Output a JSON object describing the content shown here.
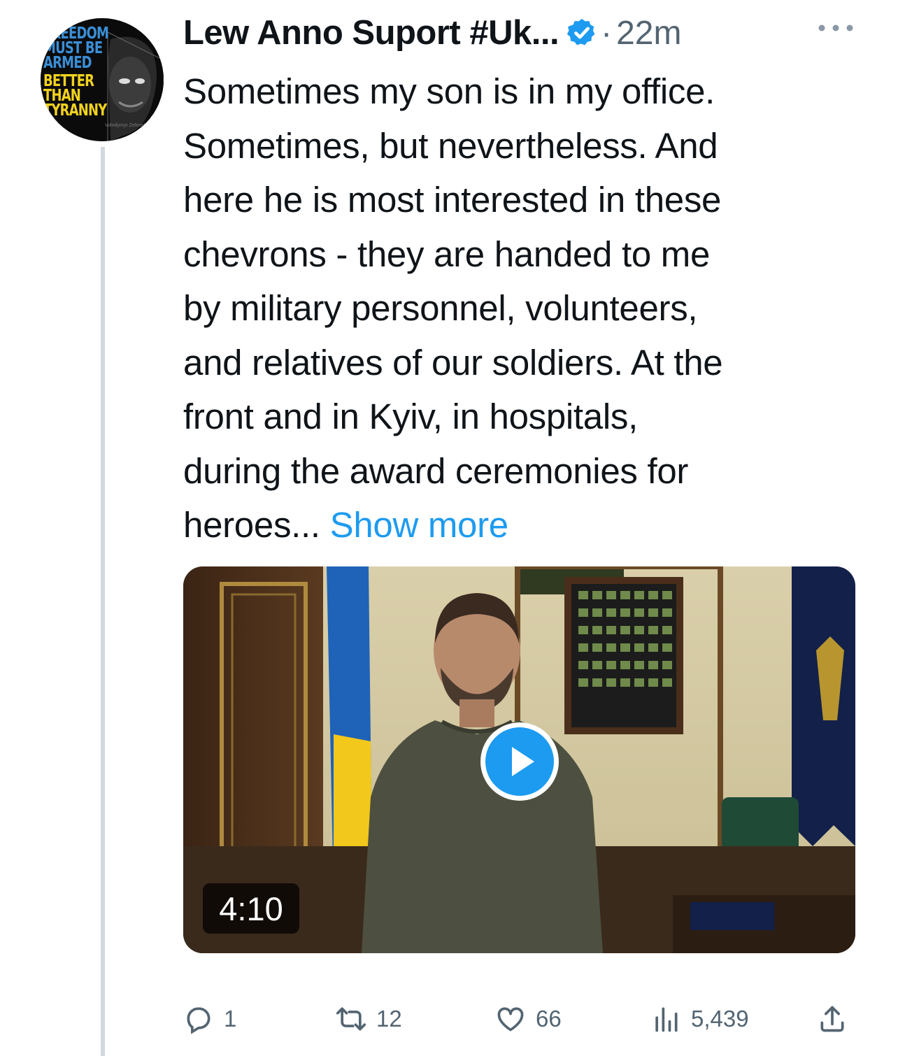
{
  "author": {
    "display_name": "Lew Anno Suport #Uk...",
    "verified": true,
    "separator": "·",
    "timestamp": "22m",
    "avatar_text": [
      "FREEDOM",
      "MUST BE",
      "ARMED",
      "BETTER",
      "THAN",
      "TYRANNY"
    ],
    "avatar_caption": "Volodymyr Zelensky"
  },
  "tweet": {
    "lines": [
      "Sometimes my son is in my office.",
      "Sometimes, but nevertheless. And",
      "here he is most interested in these",
      "chevrons - they are handed to me",
      "by military personnel, volunteers,",
      "and relatives of our soldiers. At the",
      "front and in Kyiv, in hospitals,",
      "during the award ceremonies for",
      "heroes..."
    ],
    "show_more": "Show more"
  },
  "media": {
    "type": "video",
    "duration": "4:10"
  },
  "actions": {
    "replies": "1",
    "retweets": "12",
    "likes": "66",
    "views": "5,439"
  },
  "colors": {
    "accent": "#1d9bf0",
    "muted": "#536471",
    "thread_line": "#cfd9de"
  },
  "icons": [
    "verified-badge-icon",
    "more-icon",
    "play-icon",
    "reply-icon",
    "retweet-icon",
    "like-icon",
    "views-icon",
    "share-icon"
  ]
}
